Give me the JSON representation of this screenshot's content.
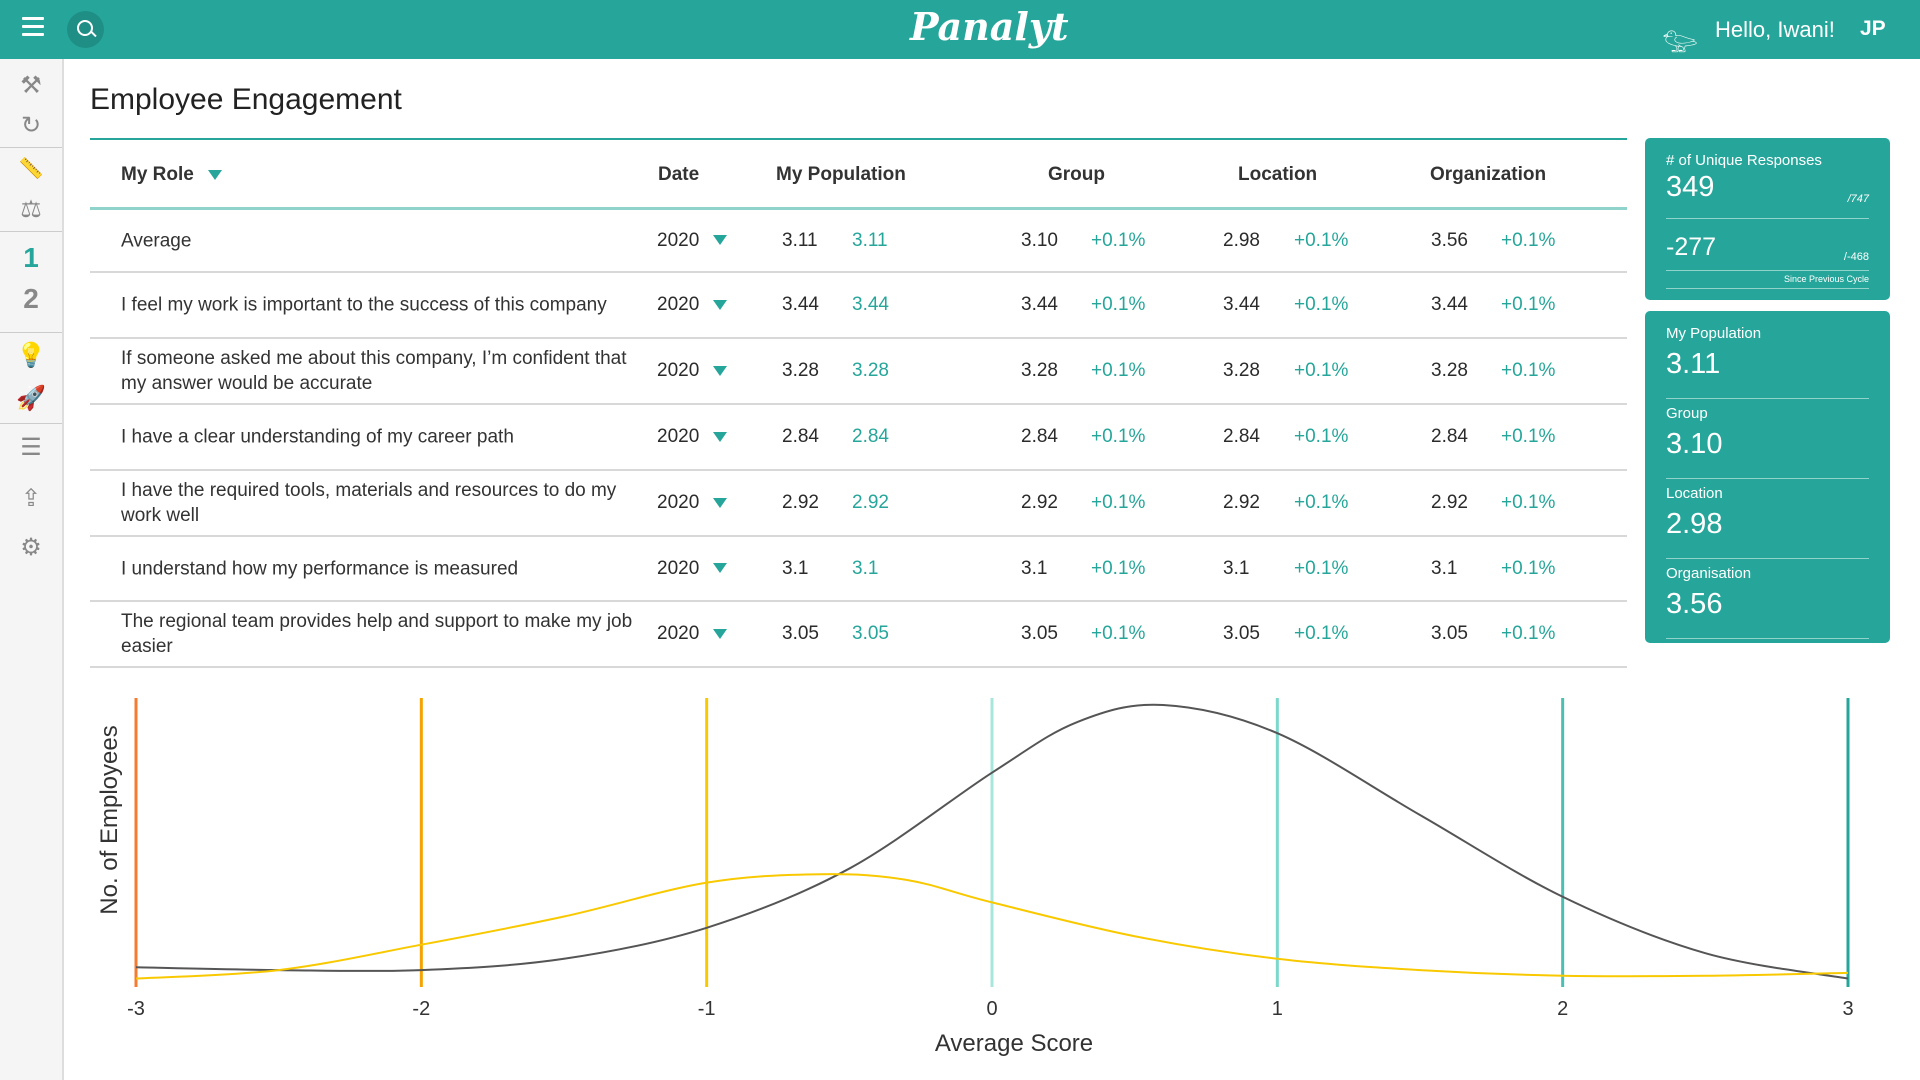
{
  "header": {
    "logo": "Panalyt",
    "greeting": "Hello, Iwani!",
    "initials": "JP"
  },
  "sidebar": {
    "items": [
      "drill-icon",
      "refresh-icon",
      "ruler-icon",
      "scales-icon",
      "one-icon",
      "two-icon",
      "bulb-icon",
      "rocket-icon",
      "list-icon",
      "share-icon",
      "gear-icon"
    ],
    "active": "one-icon",
    "accent": "#26a69a"
  },
  "page": {
    "title": "Employee Engagement"
  },
  "table": {
    "headers": {
      "role": "My Role",
      "date": "Date",
      "my_population": "My Population",
      "group": "Group",
      "location": "Location",
      "organization": "Organization"
    },
    "rows": [
      {
        "label": "Average",
        "date": "2020",
        "my_pop": "3.11",
        "my_pop2": "3.11",
        "group": "3.10",
        "group_delta": "+0.1%",
        "location": "2.98",
        "location_delta": "+0.1%",
        "org": "3.56",
        "org_delta": "+0.1%"
      },
      {
        "label": "I feel my work is important to the success of this company",
        "date": "2020",
        "my_pop": "3.44",
        "my_pop2": "3.44",
        "group": "3.44",
        "group_delta": "+0.1%",
        "location": "3.44",
        "location_delta": "+0.1%",
        "org": "3.44",
        "org_delta": "+0.1%"
      },
      {
        "label": "If someone asked me about this company, I’m confident that my answer would be accurate",
        "date": "2020",
        "my_pop": "3.28",
        "my_pop2": "3.28",
        "group": "3.28",
        "group_delta": "+0.1%",
        "location": "3.28",
        "location_delta": "+0.1%",
        "org": "3.28",
        "org_delta": "+0.1%"
      },
      {
        "label": "I have a clear understanding of my career path",
        "date": "2020",
        "my_pop": "2.84",
        "my_pop2": "2.84",
        "group": "2.84",
        "group_delta": "+0.1%",
        "location": "2.84",
        "location_delta": "+0.1%",
        "org": "2.84",
        "org_delta": "+0.1%"
      },
      {
        "label": "I have the required tools, materials and resources  to do my work well",
        "date": "2020",
        "my_pop": "2.92",
        "my_pop2": "2.92",
        "group": "2.92",
        "group_delta": "+0.1%",
        "location": "2.92",
        "location_delta": "+0.1%",
        "org": "2.92",
        "org_delta": "+0.1%"
      },
      {
        "label": "I understand how my performance is measured",
        "date": "2020",
        "my_pop": "3.1",
        "my_pop2": "3.1",
        "group": "3.1",
        "group_delta": "+0.1%",
        "location": "3.1",
        "location_delta": "+0.1%",
        "org": "3.1",
        "org_delta": "+0.1%"
      },
      {
        "label": "The regional team provides help and support to make my job easier",
        "date": "2020",
        "my_pop": "3.05",
        "my_pop2": "3.05",
        "group": "3.05",
        "group_delta": "+0.1%",
        "location": "3.05",
        "location_delta": "+0.1%",
        "org": "3.05",
        "org_delta": "+0.1%"
      }
    ]
  },
  "responses": {
    "label": "# of Unique Responses",
    "count": "349",
    "total": "/747",
    "change": "-277",
    "change_total": "/-468",
    "change_note": "Since Previous Cycle"
  },
  "summary": [
    {
      "label": "My Population",
      "value": "3.11"
    },
    {
      "label": "Group",
      "value": "3.10"
    },
    {
      "label": "Location",
      "value": "2.98"
    },
    {
      "label": "Organisation",
      "value": "3.56"
    }
  ],
  "chart_data": {
    "type": "line",
    "xlabel": "Average Score",
    "ylabel": "No. of Employees",
    "xlim": [
      -3,
      3
    ],
    "ylim": [
      0,
      100
    ],
    "grid": false,
    "x_ticks": [
      "-3",
      "-2",
      "-1",
      "0",
      "1",
      "2",
      "3"
    ],
    "vlines": [
      {
        "x": -3,
        "color": "#f47b30"
      },
      {
        "x": -2,
        "color": "#f5a300"
      },
      {
        "x": -1,
        "color": "#f9c900"
      },
      {
        "x": 0,
        "color": "#a8e6dc"
      },
      {
        "x": 1,
        "color": "#7dd8cc"
      },
      {
        "x": 2,
        "color": "#4bbfb2"
      },
      {
        "x": 3,
        "color": "#26a69a"
      }
    ],
    "series": [
      {
        "color": "#555555",
        "x": [
          -3,
          -2.5,
          -2,
          -1.5,
          -1,
          -0.5,
          0,
          0.3,
          0.6,
          1,
          1.5,
          2,
          2.5,
          3
        ],
        "y": [
          7,
          6,
          6,
          10,
          21,
          42,
          76,
          94,
          100,
          90,
          61,
          32,
          12,
          3
        ]
      },
      {
        "color": "#f9c900",
        "x": [
          -3,
          -2.5,
          -2,
          -1.5,
          -1,
          -0.6,
          -0.3,
          0,
          0.5,
          1,
          1.5,
          2,
          2.5,
          3
        ],
        "y": [
          3,
          6,
          15,
          25,
          37,
          40,
          38,
          30,
          18,
          10,
          6,
          4,
          4,
          5
        ]
      }
    ]
  }
}
